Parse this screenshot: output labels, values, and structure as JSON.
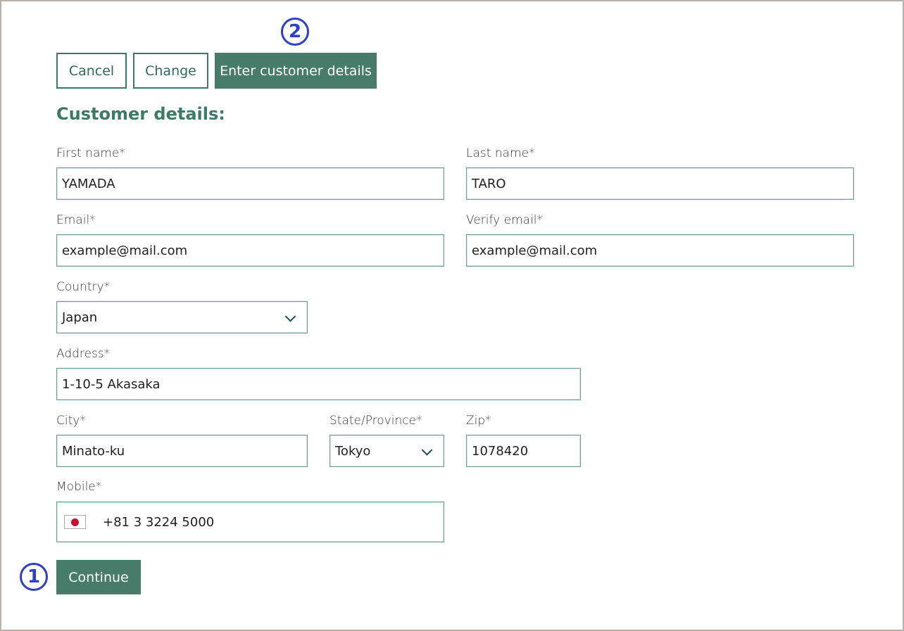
{
  "markers": {
    "top": "2",
    "bottom": "1"
  },
  "actions": {
    "cancel": "Cancel",
    "change": "Change",
    "enter_details": "Enter customer details"
  },
  "heading": "Customer details:",
  "form": {
    "first_name": {
      "label": "First name*",
      "value": "YAMADA"
    },
    "last_name": {
      "label": "Last name*",
      "value": "TARO"
    },
    "email": {
      "label": "Email*",
      "value": "example@mail.com"
    },
    "verify_email": {
      "label": "Verify email*",
      "value": "example@mail.com"
    },
    "country": {
      "label": "Country*",
      "value": "Japan"
    },
    "address": {
      "label": "Address*",
      "value": "1-10-5 Akasaka"
    },
    "city": {
      "label": "City*",
      "value": "Minato-ku"
    },
    "state": {
      "label": "State/Province*",
      "value": "Tokyo"
    },
    "zip": {
      "label": "Zip*",
      "value": "1078420"
    },
    "mobile": {
      "label": "Mobile*",
      "value": "+81 3 3224 5000",
      "flag_icon": "japan-flag-icon"
    }
  },
  "continue_label": "Continue",
  "colors": {
    "brand": "#477c6b",
    "marker": "#2e3fc9"
  }
}
